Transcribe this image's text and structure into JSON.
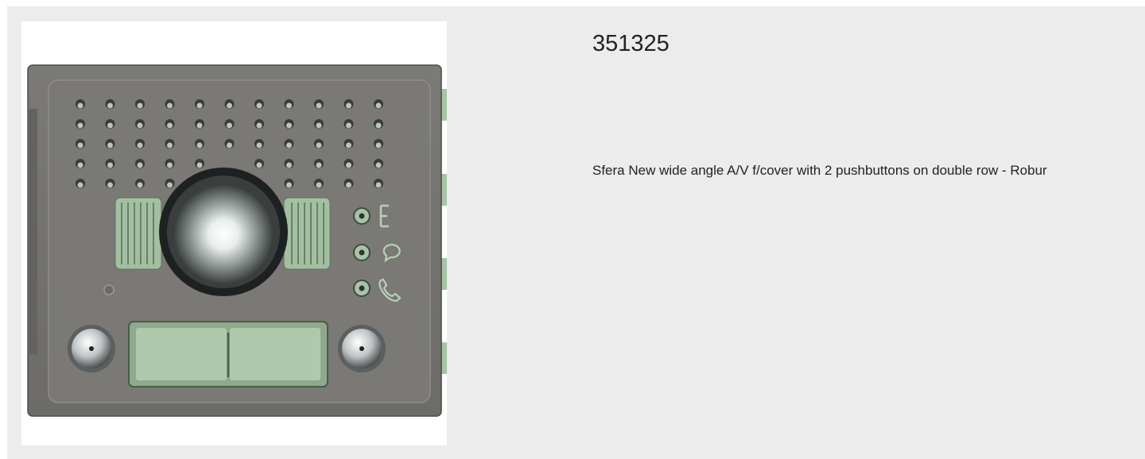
{
  "product": {
    "code": "351325",
    "description": "Sfera New wide angle A/V f/cover with 2 pushbuttons on double row - Robur"
  },
  "image": {
    "icons": [
      "key-icon",
      "speech-icon",
      "phone-icon"
    ]
  },
  "colors": {
    "card_background": "#ececec",
    "panel_body": "#74736f",
    "button_green": "#a8c4a6",
    "text": "#222222"
  }
}
